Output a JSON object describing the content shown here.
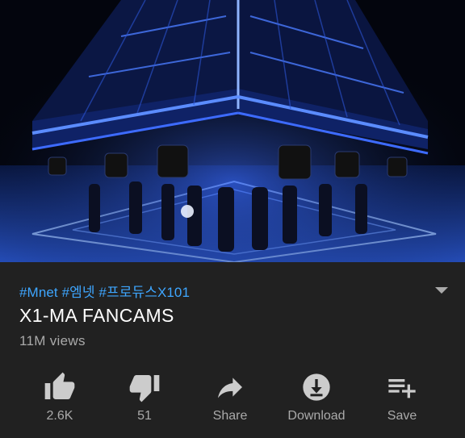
{
  "video": {
    "description": ""
  },
  "details": {
    "tags": "#Mnet #엠넷 #프로듀스X101",
    "title": "X1-MA FANCAMS",
    "views": "11M views"
  },
  "actions": [
    {
      "icon": "thumbs-up-icon",
      "label": "2.6K"
    },
    {
      "icon": "thumbs-down-icon",
      "label": "51"
    },
    {
      "icon": "share-icon",
      "label": "Share"
    },
    {
      "icon": "download-icon",
      "label": "Download"
    },
    {
      "icon": "playlist-add-icon",
      "label": "Save"
    }
  ],
  "colors": {
    "background": "#212121",
    "accent_link": "#3ea6ff",
    "secondary_text": "#aaaaaa",
    "icon": "#cccccc"
  }
}
